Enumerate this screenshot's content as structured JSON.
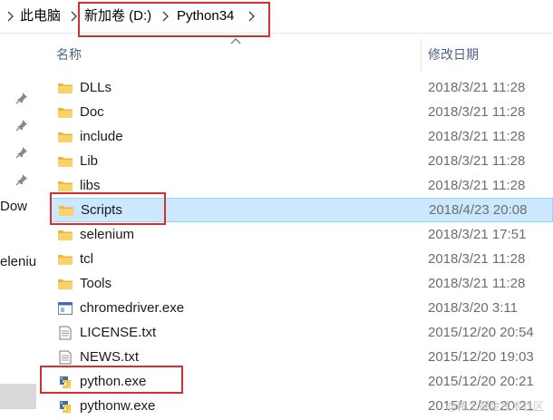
{
  "breadcrumb": {
    "items": [
      {
        "label": "此电脑"
      },
      {
        "label": "新加卷 (D:)"
      },
      {
        "label": "Python34"
      }
    ]
  },
  "navigation": {
    "partial_items": [
      "Dow",
      "eleniu"
    ]
  },
  "columns": {
    "name": "名称",
    "date_modified": "修改日期"
  },
  "files": [
    {
      "name": "DLLs",
      "date": "2018/3/21 11:28",
      "type": "folder"
    },
    {
      "name": "Doc",
      "date": "2018/3/21 11:28",
      "type": "folder"
    },
    {
      "name": "include",
      "date": "2018/3/21 11:28",
      "type": "folder"
    },
    {
      "name": "Lib",
      "date": "2018/3/21 11:28",
      "type": "folder"
    },
    {
      "name": "libs",
      "date": "2018/3/21 11:28",
      "type": "folder"
    },
    {
      "name": "Scripts",
      "date": "2018/4/23 20:08",
      "type": "folder",
      "selected": true
    },
    {
      "name": "selenium",
      "date": "2018/3/21 17:51",
      "type": "folder"
    },
    {
      "name": "tcl",
      "date": "2018/3/21 11:28",
      "type": "folder"
    },
    {
      "name": "Tools",
      "date": "2018/3/21 11:28",
      "type": "folder"
    },
    {
      "name": "chromedriver.exe",
      "date": "2018/3/20 3:11",
      "type": "exe"
    },
    {
      "name": "LICENSE.txt",
      "date": "2015/12/20 20:54",
      "type": "txt"
    },
    {
      "name": "NEWS.txt",
      "date": "2015/12/20 19:03",
      "type": "txt"
    },
    {
      "name": "python.exe",
      "date": "2015/12/20 20:21",
      "type": "python"
    },
    {
      "name": "pythonw.exe",
      "date": "2015/12/20 20:21",
      "type": "python"
    }
  ],
  "icons": {
    "folder": "folder-icon",
    "exe": "application-icon",
    "txt": "text-file-icon",
    "python": "python-icon",
    "pin": "pin-icon",
    "separator": "chevron-right-icon"
  },
  "colors": {
    "highlight_box": "#d32f2f",
    "selection_fill": "#cce8ff",
    "selection_border": "#99d1ff",
    "folder_yellow": "#f5c842"
  },
  "watermark": "@稀土掘金技术社区"
}
